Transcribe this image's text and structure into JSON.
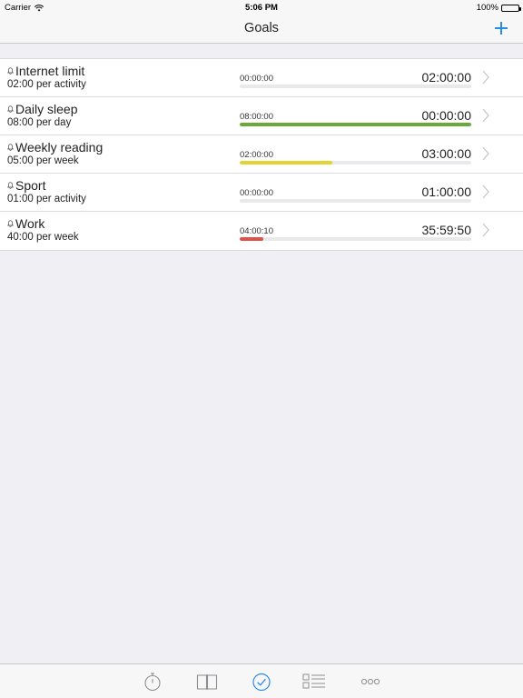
{
  "status_bar": {
    "carrier": "Carrier",
    "time": "5:06 PM",
    "battery": "100%"
  },
  "nav": {
    "title": "Goals",
    "add_icon": "plus-icon"
  },
  "colors": {
    "accent": "#2a8ae8",
    "green": "#6aaa3a",
    "yellow": "#e2d433",
    "red": "#e05248",
    "track": "#e9e9ec"
  },
  "goals": [
    {
      "name": "Internet limit",
      "target": "02:00 per activity",
      "elapsed": "00:00:00",
      "remaining": "02:00:00",
      "progress_fraction": 0.0,
      "color": "#6aaa3a"
    },
    {
      "name": "Daily sleep",
      "target": "08:00 per day",
      "elapsed": "08:00:00",
      "remaining": "00:00:00",
      "progress_fraction": 1.0,
      "color": "#6aaa3a"
    },
    {
      "name": "Weekly reading",
      "target": "05:00 per week",
      "elapsed": "02:00:00",
      "remaining": "03:00:00",
      "progress_fraction": 0.4,
      "color": "#e2d433"
    },
    {
      "name": "Sport",
      "target": "01:00 per activity",
      "elapsed": "00:00:00",
      "remaining": "01:00:00",
      "progress_fraction": 0.0,
      "color": "#6aaa3a"
    },
    {
      "name": "Work",
      "target": "40:00 per week",
      "elapsed": "04:00:10",
      "remaining": "35:59:50",
      "progress_fraction": 0.1,
      "color": "#e05248"
    }
  ],
  "tabs": [
    {
      "icon": "stopwatch-icon",
      "selected": false
    },
    {
      "icon": "book-icon",
      "selected": false
    },
    {
      "icon": "checkmark-circle-icon",
      "selected": true
    },
    {
      "icon": "list-icon",
      "selected": false
    },
    {
      "icon": "more-icon",
      "selected": false
    }
  ]
}
